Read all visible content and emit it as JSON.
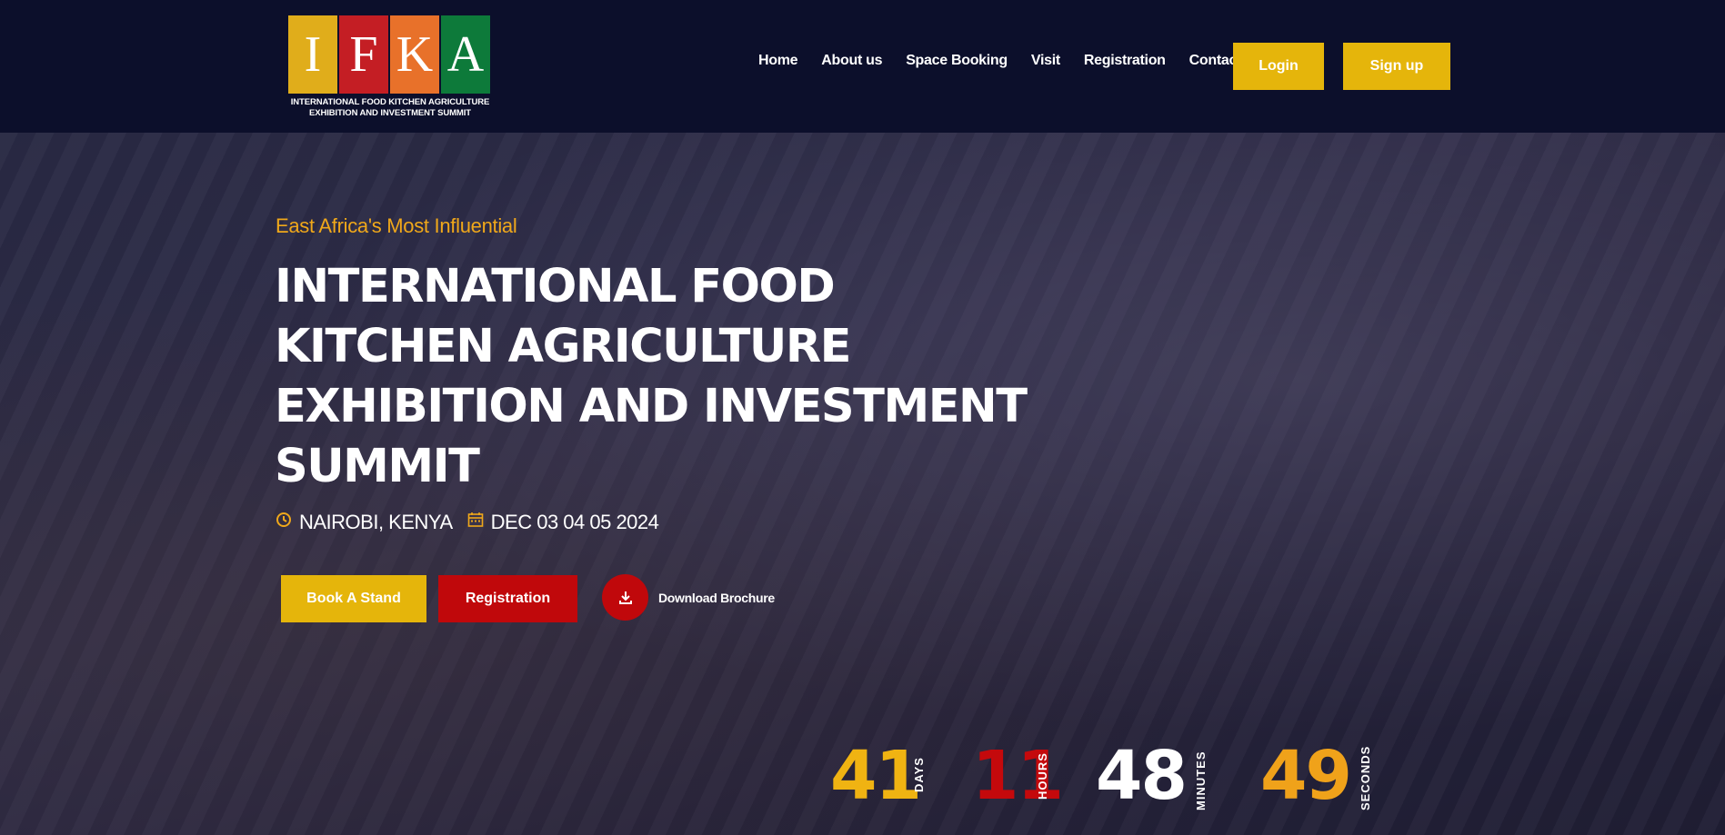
{
  "header": {
    "logo": {
      "letters": [
        "I",
        "F",
        "K",
        "A"
      ],
      "colors": [
        "#e0ad1b",
        "#c41e24",
        "#e8712a",
        "#0d7a3a"
      ],
      "subtitle_line1": "INTERNATIONAL FOOD KITCHEN AGRICULTURE",
      "subtitle_line2": "EXHIBITION AND INVESTMENT SUMMIT"
    },
    "nav": [
      "Home",
      "About us",
      "Space Booking",
      "Visit",
      "Registration",
      "Contact us"
    ],
    "login_label": "Login",
    "signup_label": "Sign up"
  },
  "hero": {
    "tagline": "East Africa's Most Influential",
    "title_lines": [
      "INTERNATIONAL FOOD",
      "KITCHEN AGRICULTURE",
      "EXHIBITION AND INVESTMENT",
      "SUMMIT"
    ],
    "location": "NAIROBI, KENYA",
    "dates": "DEC 03 04 05 2024",
    "book_stand_label": "Book A Stand",
    "registration_label": "Registration",
    "download_label": "Download Brochure"
  },
  "countdown": [
    {
      "value": "41",
      "label": "DAYS",
      "color": "#f0b312"
    },
    {
      "value": "11",
      "label": "HOURS",
      "color": "#c4090c"
    },
    {
      "value": "48",
      "label": "MINUTES",
      "color": "#ffffff"
    },
    {
      "value": "49",
      "label": "SECONDS",
      "color": "#f0a21a"
    }
  ],
  "icons": {
    "location": "location-pin-icon",
    "calendar": "calendar-icon",
    "download": "download-icon"
  },
  "colors": {
    "header_bg": "#0c0f2b",
    "accent_yellow": "#e5b50b",
    "accent_red": "#c0080b",
    "tagline_orange": "#f0a81a"
  }
}
